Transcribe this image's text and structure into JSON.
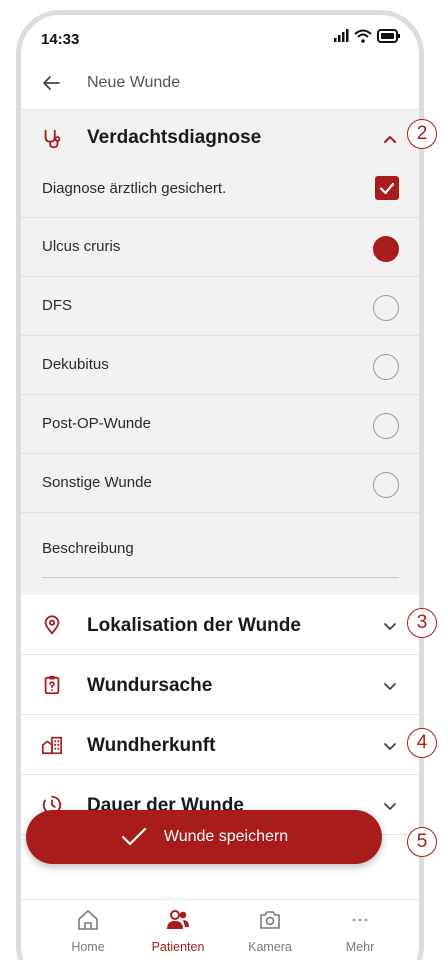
{
  "status": {
    "time": "14:33"
  },
  "appbar": {
    "title": "Neue Wunde"
  },
  "diagnosis": {
    "title": "Verdachtsdiagnose",
    "confirmed_label": "Diagnose ärztlich gesichert.",
    "confirmed": true,
    "options": [
      {
        "label": "Ulcus cruris",
        "selected": true
      },
      {
        "label": "DFS",
        "selected": false
      },
      {
        "label": "Dekubitus",
        "selected": false
      },
      {
        "label": "Post-OP-Wunde",
        "selected": false
      },
      {
        "label": "Sonstige Wunde",
        "selected": false
      }
    ],
    "description_label": "Beschreibung"
  },
  "sections": [
    {
      "title": "Lokalisation der Wunde",
      "icon": "location-pin-icon"
    },
    {
      "title": "Wundursache",
      "icon": "clipboard-question-icon"
    },
    {
      "title": "Wundherkunft",
      "icon": "building-icon"
    },
    {
      "title": "Dauer der Wunde",
      "icon": "timer-icon"
    }
  ],
  "save_button": {
    "label": "Wunde speichern"
  },
  "tabs": [
    {
      "label": "Home",
      "icon": "home-icon",
      "active": false
    },
    {
      "label": "Patienten",
      "icon": "patients-icon",
      "active": true
    },
    {
      "label": "Kamera",
      "icon": "camera-icon",
      "active": false
    },
    {
      "label": "Mehr",
      "icon": "more-icon",
      "active": false
    }
  ],
  "callouts": [
    "2",
    "3",
    "4",
    "5"
  ],
  "colors": {
    "accent": "#a81c1c",
    "panel": "#f2f2f2"
  }
}
